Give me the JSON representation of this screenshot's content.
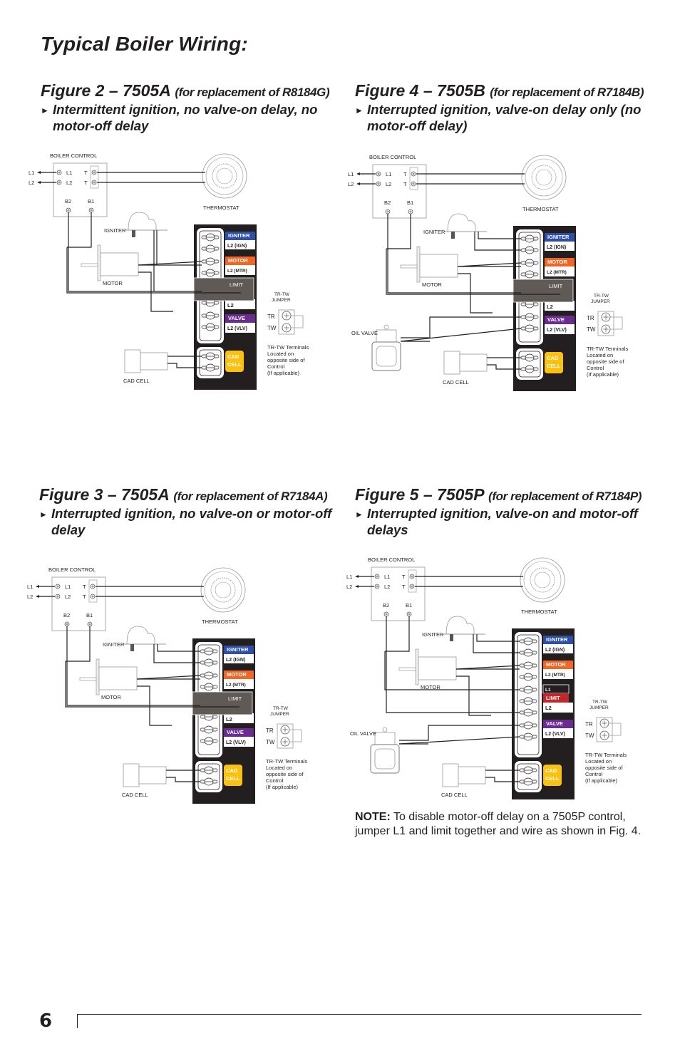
{
  "page": {
    "title": "Typical Boiler Wiring:",
    "page_number": "6"
  },
  "figures": [
    {
      "id": "fig2",
      "title": "Figure 2 – 7505A",
      "subtitle": "(for replacement of R8184G)",
      "bullet_icon": "►",
      "description": "Intermittent ignition, no valve-on delay, no motor-off delay",
      "variant": "A-intermittent",
      "has_oil_valve": false
    },
    {
      "id": "fig4",
      "title": "Figure 4 – 7505B",
      "subtitle": "(for replacement of R7184B)",
      "bullet_icon": "►",
      "description": "Interrupted ignition, valve-on delay only (no motor-off delay)",
      "variant": "B",
      "has_oil_valve": true
    },
    {
      "id": "fig3",
      "title": "Figure 3 – 7505A",
      "subtitle": "(for replacement of R7184A)",
      "bullet_icon": "►",
      "description": "Interrupted ignition, no valve-on or motor-off delay",
      "variant": "A-interrupted",
      "has_oil_valve": false
    },
    {
      "id": "fig5",
      "title": "Figure 5 – 7505P",
      "subtitle": "(for replacement of R7184P)",
      "bullet_icon": "►",
      "description": "Interrupted ignition, valve-on and motor-off delays",
      "variant": "P",
      "has_oil_valve": true
    }
  ],
  "diagram_labels": {
    "boiler_control": "BOILER CONTROL",
    "l1": "L1",
    "l2": "L2",
    "t": "T",
    "b1": "B1",
    "b2": "B2",
    "thermostat": "THERMOSTAT",
    "igniter": "IGNITER",
    "motor": "MOTOR",
    "oil_valve": "OIL VALVE",
    "cad_cell": "CAD CELL",
    "tag_igniter": "IGNITER",
    "tag_l2_ign": "L2 (IGN)",
    "tag_motor": "MOTOR",
    "tag_l2_mtr": "L2 (MTR)",
    "tag_limit": "LIMIT",
    "tag_l1": "L1",
    "tag_l2": "L2",
    "tag_valve": "VALVE",
    "tag_l2_vlv": "L2 (VLV)",
    "tag_cad": "CAD",
    "tag_cell": "CELL",
    "jumper_title_1": "TR-TW",
    "jumper_title_2": "JUMPER",
    "tr": "TR",
    "tw": "TW",
    "jumper_note": [
      "TR-TW Terminals",
      "Located on",
      "opposite side of",
      "Control",
      "(If applicable)"
    ]
  },
  "colors": {
    "igniter": "#2e4fa6",
    "motor": "#f26522",
    "valve": "#6a2c91",
    "cad_cell": "#fcc10f",
    "limit_gray": "#5f5a56",
    "limit_red": "#c1272d",
    "panel": "#231f20"
  },
  "note": {
    "label": "NOTE:",
    "text": " To disable motor-off delay on a 7505P control, jumper L1 and limit together and wire as shown in Fig. 4."
  }
}
